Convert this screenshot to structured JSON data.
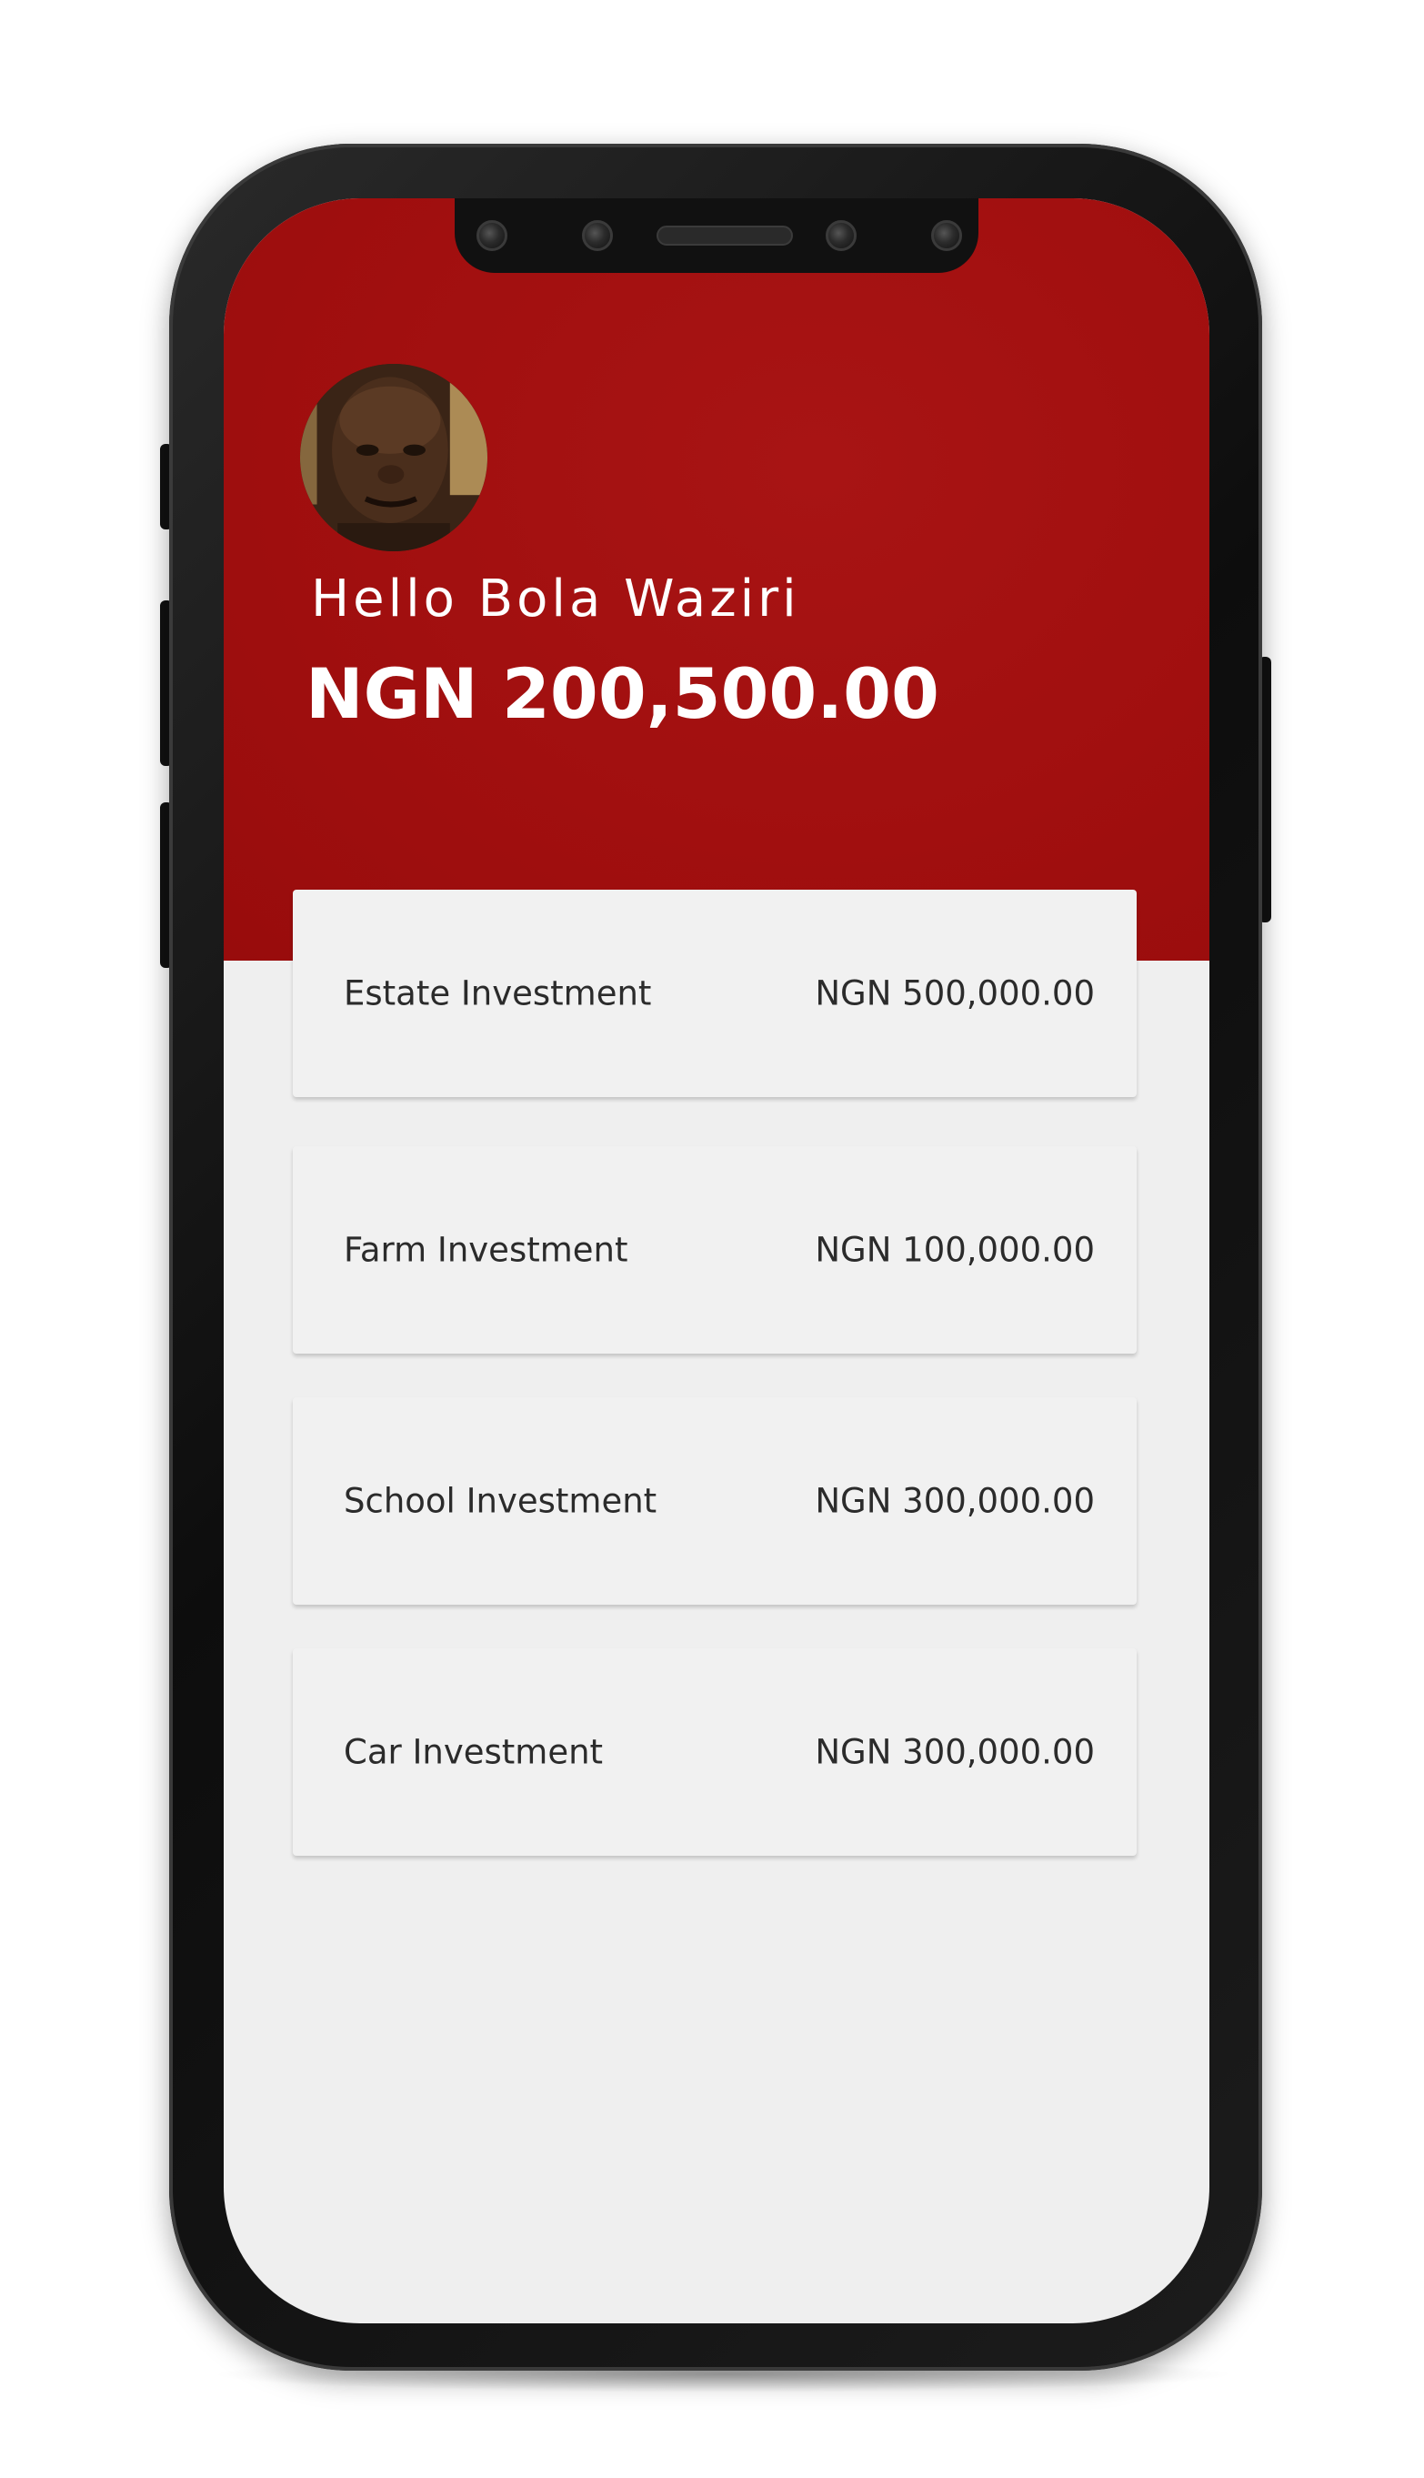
{
  "colors": {
    "header_red": "#a10f0f",
    "background": "#efefef",
    "card": "#f1f1f1",
    "text_dark": "#2b2b2b",
    "text_light": "#ffffff"
  },
  "user": {
    "greeting": "Hello Bola Waziri",
    "balance": "NGN 200,500.00",
    "avatar_icon": "user-avatar"
  },
  "investments": [
    {
      "label": "Estate Investment",
      "amount": "NGN 500,000.00"
    },
    {
      "label": "Farm Investment",
      "amount": "NGN 100,000.00"
    },
    {
      "label": "School Investment",
      "amount": "NGN 300,000.00"
    },
    {
      "label": "Car Investment",
      "amount": "NGN 300,000.00"
    }
  ]
}
